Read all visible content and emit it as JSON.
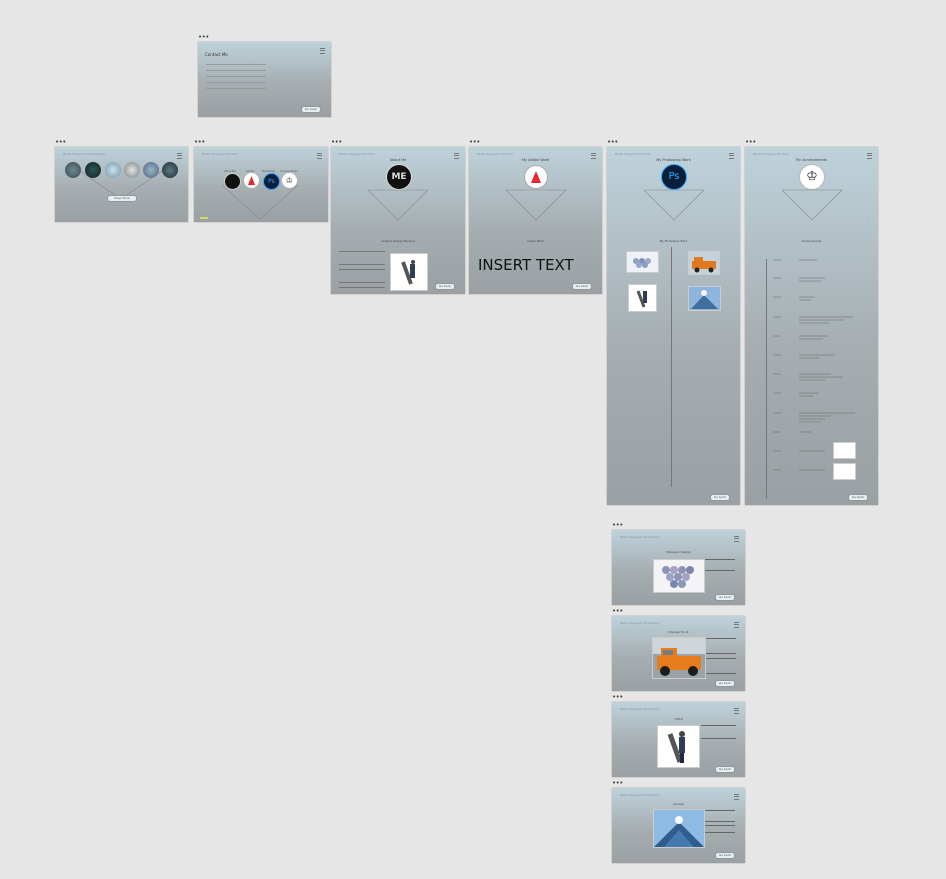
{
  "artboards": {
    "contact": {
      "title": "Contact Me",
      "button": "Go back",
      "rows": [
        "Name",
        "Email",
        "Phone",
        "Website",
        "LinkedIn"
      ]
    },
    "gallery": {
      "header": "Blake Tongeren Photography",
      "button": "View More"
    },
    "portfolio": {
      "header": "Blake Tongeren Portfolio",
      "labels": [
        "About Me",
        "Adobe",
        "Photoshop",
        "Achievements"
      ]
    },
    "about": {
      "header": "Blake Tongeren Portfolio",
      "title": "About Me",
      "subtitle": "Graphic Design Student",
      "button": "Go back"
    },
    "adobe": {
      "header": "Blake Tongeren Portfolio",
      "title": "My Adobe Work",
      "subtitle": "Adobe Work",
      "insert_text": "INSERT TEXT",
      "button": "Go back",
      "next": "Next"
    },
    "photoshop": {
      "header": "Blake Tongeren Portfolio",
      "title": "My Photoshop Work",
      "subtitle": "My Photoshop Work",
      "button": "Go back",
      "next": "Next"
    },
    "achievements": {
      "header": "Blake Tongeren Portfolio",
      "title": "My Achievements",
      "subtitle": "Achievements",
      "button": "Go back",
      "next": "Next"
    },
    "ps1": {
      "header": "Blake Tongeren Photoshop",
      "title": "Hexagon Design",
      "button": "Go back"
    },
    "ps2": {
      "header": "Blake Tongeren Photoshop",
      "title": "Orange Truck",
      "button": "Go back"
    },
    "ps3": {
      "header": "Blake Tongeren Photoshop",
      "title": "Tilted",
      "button": "Go back"
    },
    "ps4": {
      "header": "Blake Tongeren Photoshop",
      "title": "Sunset",
      "button": "Go back"
    }
  },
  "dots_label": "•••",
  "colors": {
    "canvas": "#e6e6e6",
    "board_top": "#bed2da",
    "board_bottom": "#9aa0a3",
    "ps_blue": "#31a8ff",
    "adobe_red": "#e8262e"
  }
}
